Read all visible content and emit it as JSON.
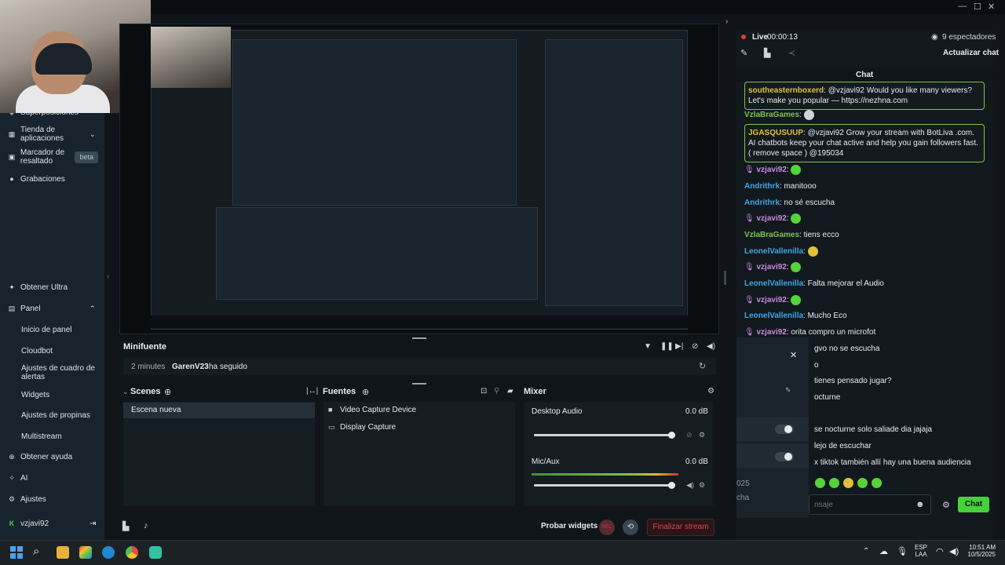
{
  "sidebar": {
    "top_items": [
      {
        "label": "Superposiciones",
        "icon": "layers-icon"
      },
      {
        "label": "Tienda de aplicaciones",
        "icon": "store-icon"
      },
      {
        "label": "Marcador de resaltado",
        "icon": "marker-icon",
        "badge": "beta"
      },
      {
        "label": "Grabaciones",
        "icon": "record-icon"
      }
    ],
    "items": [
      {
        "label": "Obtener Ultra",
        "icon": "ultra-icon"
      },
      {
        "label": "Panel",
        "icon": "dashboard-icon"
      }
    ],
    "panel_sub": [
      "Inicio de panel",
      "Cloudbot",
      "Ajustes de cuadro de alertas",
      "Widgets",
      "Ajustes de propinas",
      "Multistream"
    ],
    "bottom_items": [
      {
        "label": "Obtener ayuda",
        "icon": "help-icon"
      },
      {
        "label": "AI",
        "icon": "ai-icon"
      },
      {
        "label": "Ajustes",
        "icon": "settings-icon"
      }
    ],
    "user": "vzjavi92"
  },
  "minifuente": {
    "title": "Minifuente",
    "time": "2 minutes",
    "user": "GarenV23",
    "action": "ha seguido"
  },
  "scenes": {
    "title": "Scenes",
    "items": [
      "Escena nueva"
    ]
  },
  "sources": {
    "title": "Fuentes",
    "items": [
      {
        "label": "Video Capture Device",
        "icon": "camera-icon"
      },
      {
        "label": "Display Capture",
        "icon": "monitor-icon"
      }
    ]
  },
  "mixer": {
    "title": "Mixer",
    "channels": [
      {
        "name": "Desktop Audio",
        "db": "0.0 dB",
        "level": 1.0
      },
      {
        "name": "Mic/Aux",
        "db": "0.0 dB",
        "level": 1.0
      }
    ]
  },
  "footer": {
    "test_widgets": "Probar widgets",
    "rec": "REC",
    "end_stream": "Finalizar stream"
  },
  "live": {
    "status": "Live",
    "time": "00:00:13",
    "viewers": "9 espectadores",
    "refresh": "Actualizar chat"
  },
  "chat": {
    "title": "Chat",
    "messages": [
      {
        "user": "southeasternboxerd",
        "text": ": @vzjavi92 Would you like many viewers? Let's make you popular — https://nezhna.com",
        "highlight": true,
        "color": "u1"
      },
      {
        "user": "VzlaBraGames",
        "text": ":",
        "emote": true,
        "color": "u2"
      },
      {
        "user": "JGASQUSUUP",
        "text": ": @vzjavi92 Grow your stream with BotLiva .com. AI chatbots keep your chat active and help you gain followers fast. ( remove space ) @195034",
        "highlight": true,
        "color": "u1"
      },
      {
        "user": "vzjavi92",
        "text": ":",
        "emote": true,
        "color": "u3"
      },
      {
        "user": "Andrithrk",
        "text": ": manitooo",
        "color": "u4"
      },
      {
        "user": "Andrithrk",
        "text": ": no sé escucha",
        "color": "u4"
      },
      {
        "user": "vzjavi92",
        "text": ":",
        "emote": true,
        "color": "u3"
      },
      {
        "user": "VzlaBraGames",
        "text": ": tiens ecco",
        "color": "u2"
      },
      {
        "user": "LeonelVallenilla",
        "text": ":",
        "emote": true,
        "color": "u4"
      },
      {
        "user": "vzjavi92",
        "text": ":",
        "emote": true,
        "color": "u3"
      },
      {
        "user": "LeonelVallenilla",
        "text": ": Falta mejorar el Audio",
        "color": "u4"
      },
      {
        "user": "vzjavi92",
        "text": ":",
        "emote": true,
        "color": "u3"
      },
      {
        "user": "LeonelVallenilla",
        "text": ": Mucho Eco",
        "color": "u4"
      },
      {
        "user": "vzjavi92",
        "text": ": orita compro un microfot",
        "color": "u3"
      }
    ],
    "partial_lines": [
      "gvo no se escucha",
      "o",
      "tienes pensado jugar?",
      "octurne",
      "se nocturne solo saliade dia jajaja",
      "lejo de escuchar",
      "x tiktok también allí hay una buena audiencia"
    ],
    "popup_year": "025",
    "popup_text": "cha",
    "input_placeholder": "nsaje",
    "send": "Chat"
  },
  "taskbar": {
    "lang1": "ESP",
    "lang2": "LAA",
    "time": "10:51 AM",
    "date": "10/5/2025"
  },
  "colors": {
    "accent": "#46d13a",
    "live": "#e03b3b",
    "end_stream": "#e0454b"
  }
}
